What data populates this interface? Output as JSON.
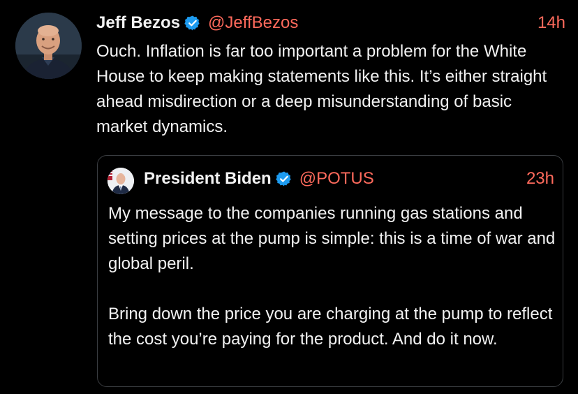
{
  "tweet": {
    "author_name": "Jeff Bezos",
    "handle": "@JeffBezos",
    "time": "14h",
    "avatar_icon": "profile-photo",
    "verified_icon": "verified-badge-icon",
    "text": "Ouch. Inflation is far too important a problem for the White House to keep making statements like this. It’s either straight ahead misdirection or a deep misunderstanding of basic market dynamics."
  },
  "quoted_tweet": {
    "author_name": "President Biden",
    "handle": "@POTUS",
    "time": "23h",
    "avatar_icon": "profile-photo",
    "verified_icon": "verified-badge-icon",
    "paragraphs": [
      "My message to the companies running gas stations and setting prices at the pump is simple: this is a time of war and global peril.",
      "Bring down the price you are charging at the pump to reflect the cost you’re paying for the product. And do it now."
    ]
  },
  "colors": {
    "background": "#000000",
    "text": "#f2f2f2",
    "accent": "#ff6a5c",
    "verified": "#1d9bf0",
    "border": "#3a3d41"
  }
}
